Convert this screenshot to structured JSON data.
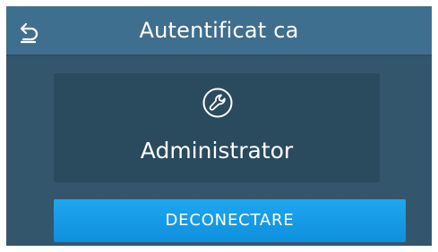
{
  "header": {
    "title": "Autentificat ca",
    "back_icon": "back-arrow-icon"
  },
  "user": {
    "role": "Administrator",
    "icon": "wrench-icon"
  },
  "actions": {
    "logout_label": "DECONECTARE"
  },
  "colors": {
    "background": "#33566d",
    "header": "#3f6f8e",
    "card": "#2a4a5e",
    "accent": "#1a9be8",
    "text": "#ffffff"
  }
}
